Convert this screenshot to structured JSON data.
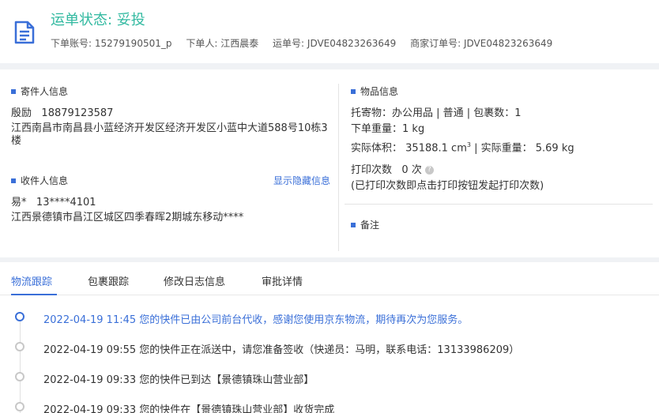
{
  "header": {
    "status_title": "运单状态: 妥投",
    "meta": [
      {
        "label": "下单账号:",
        "value": "15279190501_p"
      },
      {
        "label": "下单人:",
        "value": "江西晨泰"
      },
      {
        "label": "运单号:",
        "value": "JDVE04823263649"
      },
      {
        "label": "商家订单号:",
        "value": "JDVE04823263649"
      }
    ]
  },
  "sender": {
    "title": "寄件人信息",
    "name": "殷励",
    "phone": "18879123587",
    "address": "江西南昌市南昌县小蓝经济开发区经济开发区小蓝中大道588号10栋3楼"
  },
  "receiver": {
    "title": "收件人信息",
    "toggle_link": "显示隐藏信息",
    "name": "易*",
    "phone": "13****4101",
    "address": "江西景德镇市昌江区城区四季春晖2期城东移动****"
  },
  "goods": {
    "title": "物品信息",
    "item_line": "托寄物：办公用品 | 普通 | 包裹数：1",
    "order_weight_label": "下单重量：",
    "order_weight": "1 kg",
    "volume_label": "实际体积：",
    "volume_value": "35188.1 cm",
    "volume_sup": "3",
    "actual_weight_text": "| 实际重量： 5.69 kg",
    "print_label": "打印次数",
    "print_count": "0 次",
    "print_hint": "(已打印次数即点击打印按钮发起打印次数)"
  },
  "remarks": {
    "title": "备注"
  },
  "tabs": [
    {
      "label": "物流跟踪",
      "active": true
    },
    {
      "label": "包裹跟踪",
      "active": false
    },
    {
      "label": "修改日志信息",
      "active": false
    },
    {
      "label": "审批详情",
      "active": false
    }
  ],
  "logs": [
    {
      "text": "2022-04-19 11:45 您的快件已由公司前台代收，感谢您使用京东物流，期待再次为您服务。",
      "active": true
    },
    {
      "text": "2022-04-19 09:55 您的快件正在派送中，请您准备签收（快递员：马明，联系电话：13133986209）",
      "active": false
    },
    {
      "text": "2022-04-19 09:33 您的快件已到达【景德镇珠山营业部】",
      "active": false
    },
    {
      "text": "2022-04-19 09:33 您的快件在【景德镇珠山营业部】收货完成",
      "active": false
    }
  ],
  "colors": {
    "status_green": "#31b9a0",
    "accent_blue": "#3a6fd8"
  }
}
